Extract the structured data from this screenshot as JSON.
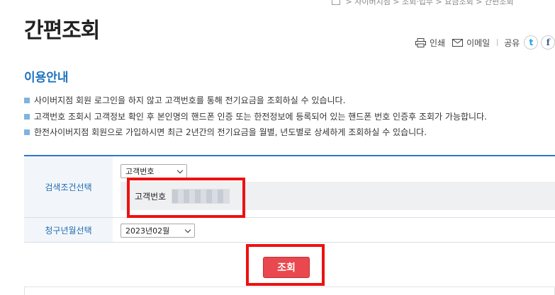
{
  "breadcrumb": [
    "사이버지점",
    "조회·업무",
    "요금조회",
    "간편조회"
  ],
  "page_title": "간편조회",
  "tools": {
    "print_label": "인쇄",
    "email_label": "이메일",
    "share_label": "공유",
    "twitter": "t",
    "facebook": "f"
  },
  "section_title": "이용안내",
  "info_items": [
    "사이버지점 회원 로그인을 하지 않고 고객번호를 통해 전기요금을 조회하실 수 있습니다.",
    "고객번호 조회시 고객정보 확인 후 본인명의 핸드폰 인증 또는 한전정보에 등록되어 있는 핸드폰 번호 인증후 조회가 가능합니다.",
    "한전사이버지점 회원으로 가입하시면 최근 2년간의 전기요금을 월별, 년도별로 상세하게 조회하실 수 있습니다."
  ],
  "form": {
    "search_condition_label": "검색조건선택",
    "search_type_selected": "고객번호",
    "customer_number_label": "고객번호",
    "billing_month_label": "청구년월선택",
    "billing_month_selected": "2023년02월"
  },
  "search_button_label": "조회",
  "colors": {
    "accent_blue": "#1e73be",
    "button_red": "#e8484e",
    "highlight_red": "#ee1111"
  }
}
